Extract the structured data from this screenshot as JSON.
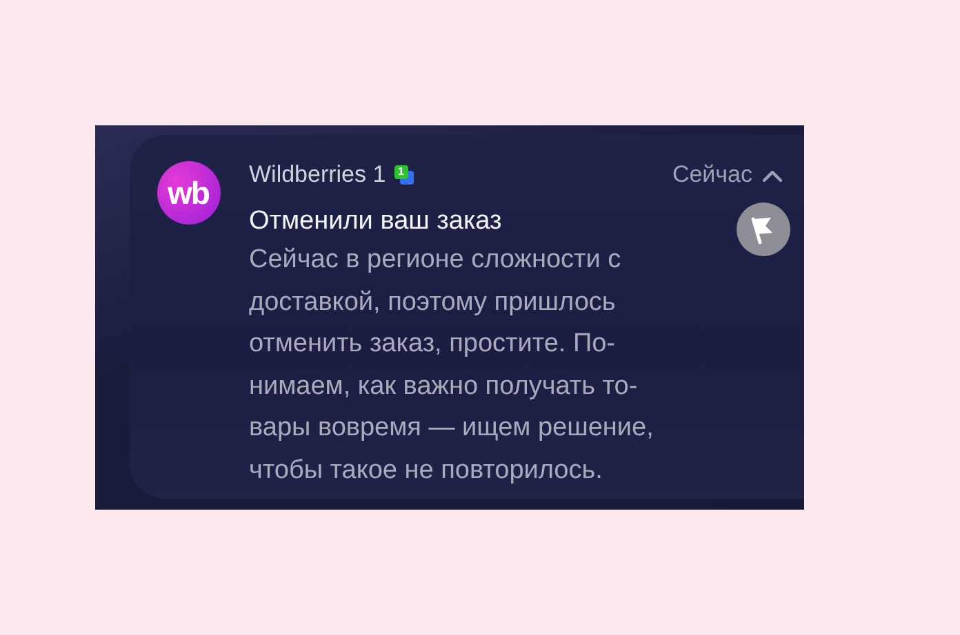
{
  "notification": {
    "logo_text": "wb",
    "app_name": "Wildberries 1",
    "app_badge": "1",
    "time": "Сейчас",
    "expanded": true,
    "title": "Отменили ваш заказ",
    "body_lines": [
      "Сейчас в регионе сложности с",
      "доставкой, поэтому пришлось",
      "отменить заказ, простите. По-",
      "нимаем, как важно получать то-",
      "вары вовремя — ищем решение,",
      "чтобы такое не повторилось."
    ]
  }
}
